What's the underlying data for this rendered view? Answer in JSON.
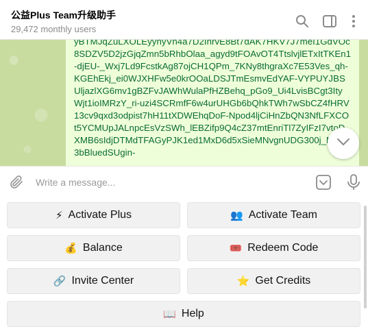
{
  "header": {
    "title": "公益Plus Team升级助手",
    "subtitle": "29,472 monthly users"
  },
  "message": {
    "text": "yBTMJqZuLXOLEyyhyVn4a7D2IhrvE8Bt7dAK7HKV7J7meI1GdVOc8SDZV5D2jzGjqZmn5bRhbOlaa_agyd9tFOAvOT4TtslvjlETxItTKEn1-djEU-_Wxj7Ld9FcstkAg87ojCH1QPm_7KNy8thgraXc7E53Ves_qh-KGEhEkj_ei0WJXHFw5e0krOOaLDSJTmEsmvEdYAF-VYPUYJBSUljazlXG6mv1gBZFvJAWhWulaPfHZBehq_pGo9_Ui4LvisBCgt3ItyWjt1ioIMRzY_ri-uzi4SCRmfF6w4urUHGb6bQhkTWh7wSbCZ4fHRV13cv9qxd3odpist7hH11tXDWEhqDoF-Npod4ljCiHnZbQN3NfLFXCOt5YCMUpJALnpcEsVzSWh_lEBZifp9Q4cZ37mtEnriTl7ZyIFzI7vtoDXMB6sIdjDTMdTFAGyPJK1ed1MxD6d5xSieMNvgnUDG300j_MT3u3bBluedSUgin-"
  },
  "composer": {
    "placeholder": "Write a message..."
  },
  "keyboard": {
    "buttons": [
      {
        "emoji": "⚡",
        "label": "Activate Plus"
      },
      {
        "emoji": "👥",
        "label": "Activate Team"
      },
      {
        "emoji": "💰",
        "label": "Balance"
      },
      {
        "emoji": "🎟️",
        "label": "Redeem Code"
      },
      {
        "emoji": "🔗",
        "label": "Invite Center"
      },
      {
        "emoji": "⭐",
        "label": "Get Credits"
      },
      {
        "emoji": "📖",
        "label": "Help"
      }
    ]
  },
  "icons": {
    "search": "search-icon",
    "sidebar": "sidebar-toggle-icon",
    "more": "more-vertical-icon",
    "attach": "paperclip-icon",
    "keyboard": "bot-keyboard-icon",
    "mic": "microphone-icon",
    "scroll": "chevron-down-icon"
  },
  "colors": {
    "chat_background": "#c8dca0",
    "bubble": "#eefed9",
    "message_text": "#0a6b35",
    "button_bg": "#f1f1f1"
  }
}
